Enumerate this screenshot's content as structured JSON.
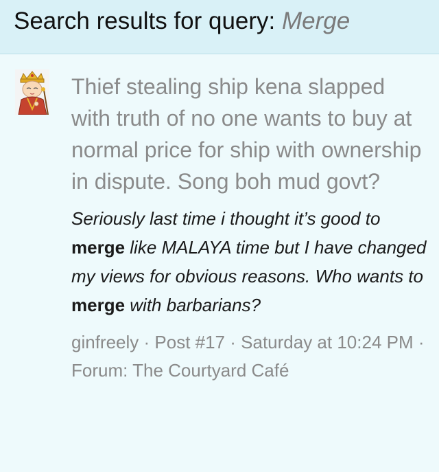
{
  "header": {
    "prefix": "Search results for query: ",
    "query": "Merge"
  },
  "result": {
    "avatar_icon": "monk-avatar-icon",
    "title": "Thief stealing ship kena slapped with truth of no one wants to buy at normal price for ship with ownership in dispute. Song boh mud govt?",
    "snippet": {
      "t1": "Seriously last time i thought it’s good to ",
      "m1": "merge",
      "t2": " like MALAYA time but I have changed my views for obvious reasons. Who wants to ",
      "m2": "merge",
      "t3": " with barbarians?"
    },
    "meta": {
      "author": "ginfreely",
      "sep": " · ",
      "post": "Post #17",
      "time": "Saturday at 10:24 PM",
      "forum_prefix": "Forum: ",
      "forum": "The Courtyard Café"
    }
  },
  "colors": {
    "header_bg": "#d9f1f7",
    "page_bg": "#eefafc",
    "muted_text": "#8a8a8a"
  }
}
